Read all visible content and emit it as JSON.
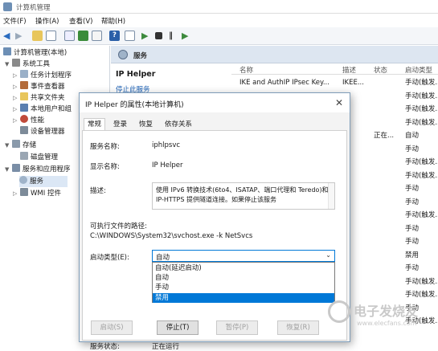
{
  "window": {
    "title": "计算机管理"
  },
  "menu": [
    "文件(F)",
    "操作(A)",
    "查看(V)",
    "帮助(H)"
  ],
  "tree": {
    "root": "计算机管理(本地)",
    "system_tools": "系统工具",
    "task_scheduler": "任务计划程序",
    "event_viewer": "事件查看器",
    "shared_folders": "共享文件夹",
    "local_users": "本地用户和组",
    "performance": "性能",
    "device_manager": "设备管理器",
    "storage": "存储",
    "disk_mgmt": "磁盘管理",
    "services_apps": "服务和应用程序",
    "services": "服务",
    "wmi": "WMI 控件"
  },
  "services_pane": {
    "header": "服务",
    "detail_title": "IP Helper",
    "detail_link": "停止此服务",
    "columns": [
      "名称",
      "描述",
      "状态",
      "启动类型"
    ],
    "rows": [
      {
        "name": "IKE and AuthIP IPsec Key...",
        "desc": "IKEE...",
        "status": "",
        "startup": "手动(触发..."
      },
      {
        "name": "...",
        "desc": "...",
        "status": "",
        "startup": "手动(触发..."
      },
      {
        "name": "",
        "desc": "",
        "status": "",
        "startup": "手动(触发..."
      },
      {
        "name": "",
        "desc": "",
        "status": "",
        "startup": "手动(触发..."
      },
      {
        "name": "",
        "desc": "",
        "status": "正在...",
        "startup": "自动"
      },
      {
        "name": "",
        "desc": "",
        "status": "",
        "startup": "手动"
      },
      {
        "name": "",
        "desc": "",
        "status": "",
        "startup": "手动(触发..."
      },
      {
        "name": "",
        "desc": "",
        "status": "",
        "startup": "手动(触发..."
      },
      {
        "name": "",
        "desc": "",
        "status": "",
        "startup": "手动"
      },
      {
        "name": "",
        "desc": "",
        "status": "",
        "startup": "手动"
      },
      {
        "name": "",
        "desc": "",
        "status": "",
        "startup": "手动(触发..."
      },
      {
        "name": "",
        "desc": "",
        "status": "",
        "startup": "手动"
      },
      {
        "name": "",
        "desc": "",
        "status": "",
        "startup": "手动"
      },
      {
        "name": "",
        "desc": "",
        "status": "",
        "startup": "禁用"
      },
      {
        "name": "",
        "desc": "",
        "status": "",
        "startup": "手动"
      },
      {
        "name": "",
        "desc": "",
        "status": "",
        "startup": "手动(触发..."
      },
      {
        "name": "",
        "desc": "",
        "status": "",
        "startup": "手动(触发..."
      },
      {
        "name": "",
        "desc": "",
        "status": "",
        "startup": "手动"
      },
      {
        "name": "",
        "desc": "",
        "status": "",
        "startup": "手动(触发..."
      }
    ]
  },
  "dialog": {
    "title": "IP Helper 的属性(本地计算机)",
    "close": "✕",
    "tabs": [
      "常规",
      "登录",
      "恢复",
      "依存关系"
    ],
    "service_name_label": "服务名称:",
    "service_name": "iphlpsvc",
    "display_name_label": "显示名称:",
    "display_name": "IP Helper",
    "desc_label": "描述:",
    "desc": "使用 IPv6 转换技术(6to4、ISATAP、端口代理和 Teredo)和 IP-HTTPS 提供隧道连接。如果停止该服务",
    "path_label": "可执行文件的路径:",
    "path": "C:\\WINDOWS\\System32\\svchost.exe -k NetSvcs",
    "startup_label": "启动类型(E):",
    "startup_value": "自动",
    "startup_options": [
      "自动(延迟启动)",
      "自动",
      "手动",
      "禁用"
    ],
    "selected_option_index": 3,
    "status_label": "服务状态:",
    "status_value": "正在运行",
    "buttons": {
      "start": "启动(S)",
      "stop": "停止(T)",
      "pause": "暂停(P)",
      "resume": "恢复(R)"
    }
  },
  "watermark": {
    "text": "电子发烧友",
    "url": "www.elecfans.com"
  }
}
